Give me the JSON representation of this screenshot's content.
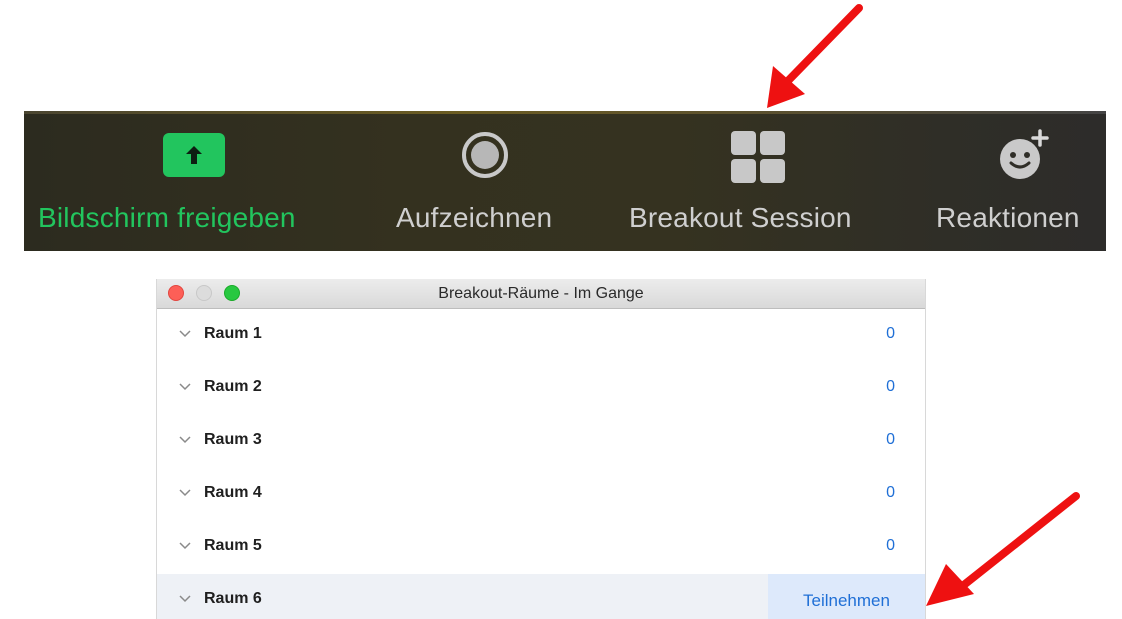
{
  "toolbar": {
    "items": [
      {
        "label": "Bildschirm freigeben",
        "icon": "share-screen-icon",
        "color": "#22c55e"
      },
      {
        "label": "Aufzeichnen",
        "icon": "record-icon",
        "color": "#cfcfcf"
      },
      {
        "label": "Breakout Session",
        "icon": "breakout-rooms-icon",
        "color": "#cfcfcf"
      },
      {
        "label": "Reaktionen",
        "icon": "reactions-icon",
        "color": "#cfcfcf"
      }
    ]
  },
  "window": {
    "title": "Breakout-Räume - Im Gange",
    "rooms": [
      {
        "name": "Raum 1",
        "count": "0"
      },
      {
        "name": "Raum 2",
        "count": "0"
      },
      {
        "name": "Raum 3",
        "count": "0"
      },
      {
        "name": "Raum 4",
        "count": "0"
      },
      {
        "name": "Raum 5",
        "count": "0"
      },
      {
        "name": "Raum 6",
        "action": "Teilnehmen"
      }
    ]
  },
  "colors": {
    "accent_green": "#22c55e",
    "link_blue": "#1f6fd6",
    "annotation_red": "#ee1111"
  }
}
